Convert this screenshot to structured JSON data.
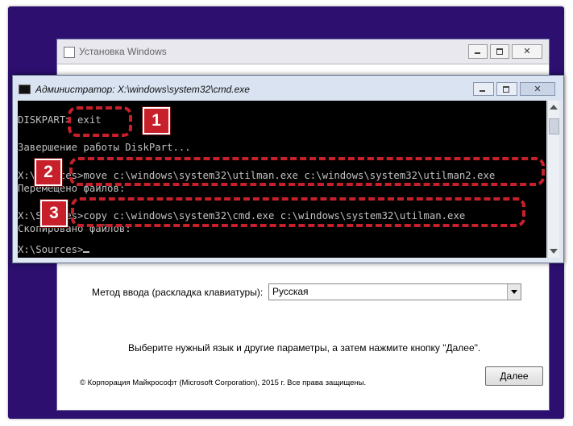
{
  "setup": {
    "title": "Установка Windows",
    "keyboard_label": "Метод ввода (раскладка клавиатуры):",
    "keyboard_value": "Русская",
    "hint": "Выберите нужный язык и другие параметры, а затем нажмите кнопку \"Далее\".",
    "copyright": "© Корпорация Майкрософт (Microsoft Corporation), 2015 г. Все права защищены.",
    "next_label": "Далее"
  },
  "cmd": {
    "title": "Администратор: X:\\windows\\system32\\cmd.exe",
    "lines": [
      "DISKPART> exit",
      "",
      "Завершение работы DiskPart...",
      "",
      "X:\\Sources>move c:\\windows\\system32\\utilman.exe c:\\windows\\system32\\utilman2.exe",
      "Перемещено файлов:",
      "",
      "X:\\Sources>copy c:\\windows\\system32\\cmd.exe c:\\windows\\system32\\utilman.exe",
      "Скопировано файлов:",
      "",
      "X:\\Sources>"
    ]
  },
  "annotations": [
    "1",
    "2",
    "3"
  ],
  "window_buttons": {
    "close": "✕"
  },
  "colors": {
    "desktop": "#2c0f6e",
    "annotation": "#c8202a",
    "console_bg": "#000000",
    "console_text": "#c0c0c0"
  }
}
